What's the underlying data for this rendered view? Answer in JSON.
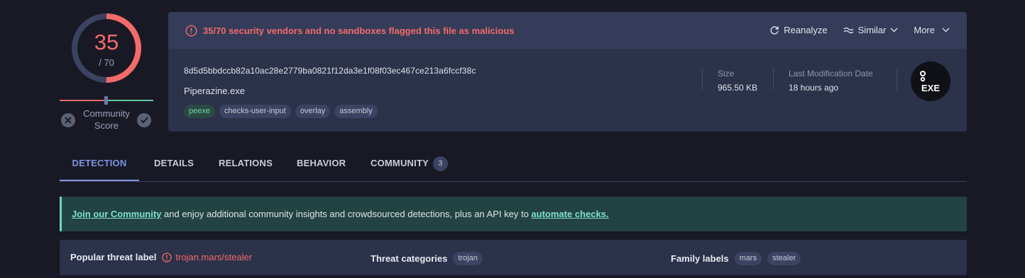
{
  "score": {
    "detected": "35",
    "total": "/ 70",
    "fraction": 0.5,
    "community_label": "Community Score"
  },
  "alert": {
    "text": "35/70 security vendors and no sandboxes flagged this file as malicious"
  },
  "actions": {
    "reanalyze": "Reanalyze",
    "similar": "Similar",
    "more": "More"
  },
  "file": {
    "hash": "8d5d5bbdccb82a10ac28e2779ba0821f12da3e1f08f03ec467ce213a6fccf38c",
    "name": "Piperazine.exe",
    "tags": [
      "peexe",
      "checks-user-input",
      "overlay",
      "assembly"
    ],
    "size_label": "Size",
    "size_value": "965.50 KB",
    "date_label": "Last Modification Date",
    "date_value": "18 hours ago",
    "type_icon": "EXE"
  },
  "tabs": [
    {
      "label": "DETECTION"
    },
    {
      "label": "DETAILS"
    },
    {
      "label": "RELATIONS"
    },
    {
      "label": "BEHAVIOR"
    },
    {
      "label": "COMMUNITY",
      "count": "3"
    }
  ],
  "banner": {
    "link1": "Join our Community",
    "text": " and enjoy additional community insights and crowdsourced detections, plus an API key to ",
    "link2": "automate checks."
  },
  "threat": {
    "popular_label": "Popular threat label",
    "popular_value": "trojan.mars/stealer",
    "categories_label": "Threat categories",
    "categories": [
      "trojan"
    ],
    "family_label": "Family labels",
    "families": [
      "mars",
      "stealer"
    ]
  },
  "colors": {
    "background": "#191926",
    "card": "#2b324a",
    "danger": "#f36a6a",
    "accent": "#7b93e0",
    "success": "#5fc99b"
  }
}
